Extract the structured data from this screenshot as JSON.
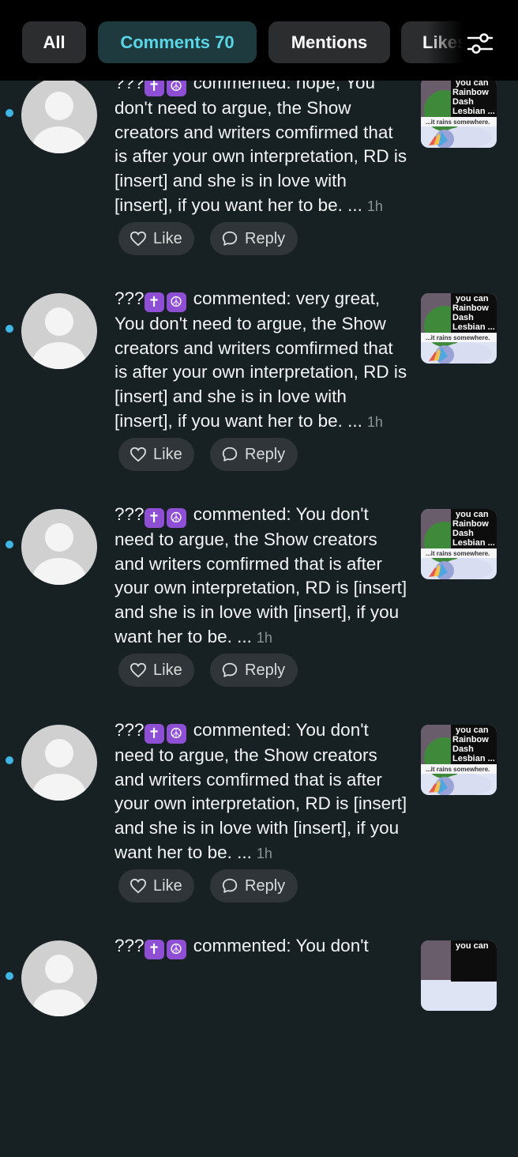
{
  "tabs": {
    "all": "All",
    "comments": "Comments 70",
    "mentions": "Mentions",
    "likes": "Likes"
  },
  "filter_icon": "sliders-icon",
  "comments": [
    {
      "name": "???",
      "badge1": "✝",
      "badge2": "☮",
      "body": " commented: nope, You don't need to argue, the Show creators and writers comfirmed that is after your own interpretation, RD is [insert] and she is in love with [insert], if you want her to be. ...",
      "time": "1h",
      "like": "Like",
      "reply": "Reply",
      "thumb_line1": "you can",
      "thumb_line2": "Rainbow",
      "thumb_line3": "Dash",
      "thumb_line4": "Lesbian ...",
      "thumb_caption": "...it rains somewhere."
    },
    {
      "name": "???",
      "badge1": "✝",
      "badge2": "☮",
      "body": " commented: very great, You don't need to argue, the Show creators and writers comfirmed that is after your own interpretation, RD is [insert] and she is in love with [insert], if you want her to be. ...",
      "time": "1h",
      "like": "Like",
      "reply": "Reply",
      "thumb_line1": "you can",
      "thumb_line2": "Rainbow",
      "thumb_line3": "Dash",
      "thumb_line4": "Lesbian ...",
      "thumb_caption": "...it rains somewhere."
    },
    {
      "name": "???",
      "badge1": "✝",
      "badge2": "☮",
      "body": " commented: You don't need to argue, the Show creators and writers comfirmed that is after your own interpretation, RD is [insert] and she is in love with [insert], if you want her to be. ...",
      "time": "1h",
      "like": "Like",
      "reply": "Reply",
      "thumb_line1": "you can",
      "thumb_line2": "Rainbow",
      "thumb_line3": "Dash",
      "thumb_line4": "Lesbian ...",
      "thumb_caption": "...it rains somewhere."
    },
    {
      "name": "???",
      "badge1": "✝",
      "badge2": "☮",
      "body": " commented: You don't need to argue, the Show creators and writers comfirmed that is after your own interpretation, RD is [insert] and she is in love with [insert], if you want her to be. ...",
      "time": "1h",
      "like": "Like",
      "reply": "Reply",
      "thumb_line1": "you can",
      "thumb_line2": "Rainbow",
      "thumb_line3": "Dash",
      "thumb_line4": "Lesbian ...",
      "thumb_caption": "...it rains somewhere."
    },
    {
      "name": "???",
      "badge1": "✝",
      "badge2": "☮",
      "body": " commented: You don't",
      "time": "",
      "like": "",
      "reply": "",
      "thumb_line1": "you can",
      "thumb_line2": "",
      "thumb_line3": "",
      "thumb_line4": "",
      "thumb_caption": ""
    }
  ]
}
